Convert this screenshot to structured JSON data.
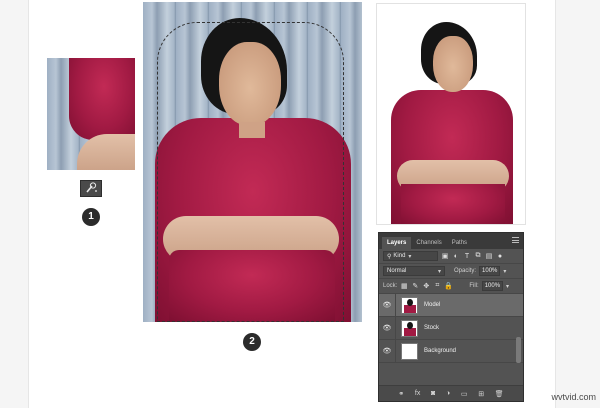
{
  "steps": [
    "1",
    "2"
  ],
  "layers_panel": {
    "tabs": [
      "Layers",
      "Channels",
      "Paths"
    ],
    "filter_kind": "Kind",
    "blend_mode": "Normal",
    "opacity_label": "Opacity:",
    "opacity_value": "100%",
    "lock_label": "Lock:",
    "fill_label": "Fill:",
    "fill_value": "100%",
    "layers": [
      {
        "name": "Model",
        "selected": true
      },
      {
        "name": "Stock",
        "selected": false
      },
      {
        "name": "Background",
        "selected": false
      }
    ],
    "bottom_icons": [
      "link-icon",
      "fx-icon",
      "mask-icon",
      "adjustment-icon",
      "group-folder-icon",
      "new-layer-icon",
      "trash-icon"
    ],
    "bottom_glyphs": [
      "⚭",
      "fx",
      "◙",
      "◑",
      "▭",
      "⊞",
      "🗑"
    ]
  },
  "watermark": "wvtvid.com",
  "colors": {
    "shirt": "#a11a43",
    "panel_bg": "#535353",
    "panel_selected": "#6a6a6a"
  }
}
